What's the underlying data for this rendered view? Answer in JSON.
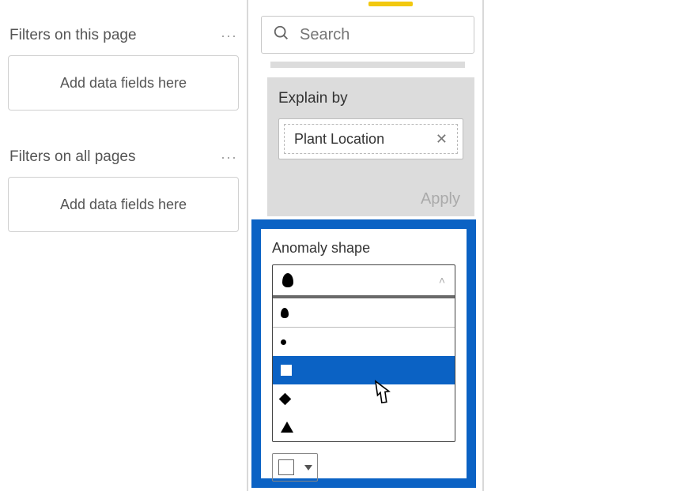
{
  "filters": {
    "page_header": "Filters on this page",
    "page_placeholder": "Add data fields here",
    "all_header": "Filters on all pages",
    "all_placeholder": "Add data fields here",
    "ellipsis": "···"
  },
  "search": {
    "placeholder": "Search"
  },
  "explain": {
    "title": "Explain by",
    "chip_label": "Plant Location",
    "apply_label": "Apply"
  },
  "anomaly": {
    "title": "Anomaly shape",
    "options": [
      "drop",
      "dot",
      "square",
      "diamond",
      "triangle"
    ],
    "selected": "square",
    "header_shape": "drop"
  }
}
